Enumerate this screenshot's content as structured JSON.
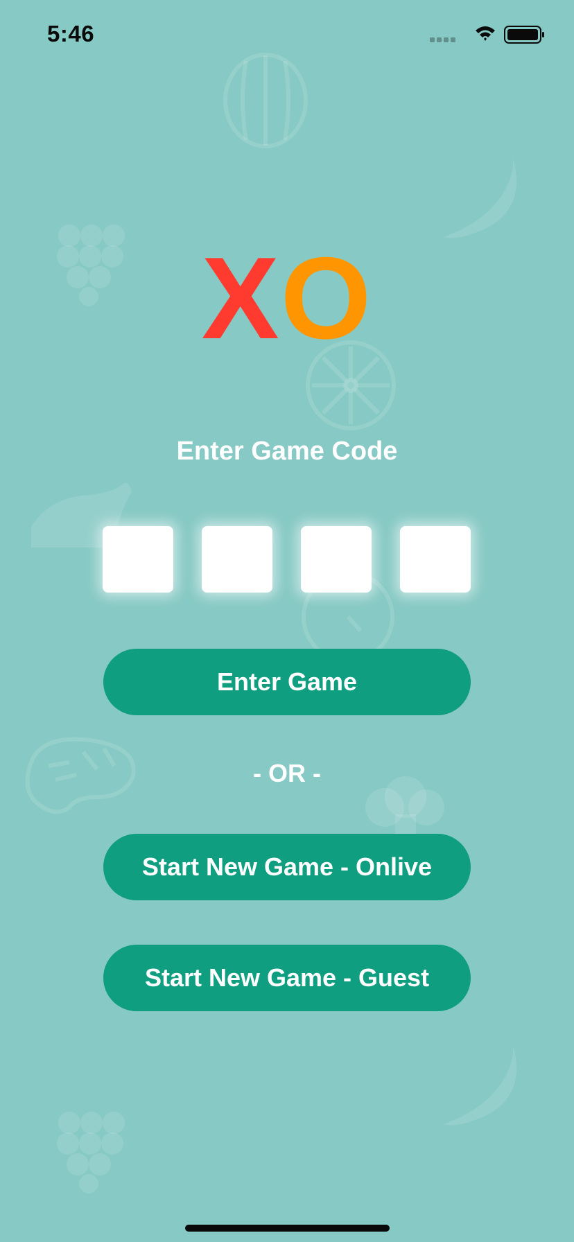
{
  "status_bar": {
    "time": "5:46",
    "icons": [
      "signal-icon",
      "wifi-icon",
      "battery-icon"
    ]
  },
  "logo": {
    "x_letter": "X",
    "o_letter": "O",
    "x_color": "#ff3b30",
    "o_color": "#ff9500"
  },
  "code_entry": {
    "title": "Enter Game Code",
    "digits": [
      "",
      "",
      "",
      ""
    ]
  },
  "buttons": {
    "enter_game": "Enter Game",
    "or_separator": "- OR -",
    "start_online": "Start New Game - Onlive",
    "start_guest": "Start New Game - Guest"
  },
  "colors": {
    "background": "#87c9c4",
    "button": "#0f9e80",
    "text_light": "#ffffff"
  },
  "background_icons": [
    "watermelon-icon",
    "banana-icon",
    "grapes-icon",
    "citrus-slice-icon",
    "roast-chicken-icon",
    "clock-icon",
    "steak-icon",
    "broccoli-icon"
  ]
}
